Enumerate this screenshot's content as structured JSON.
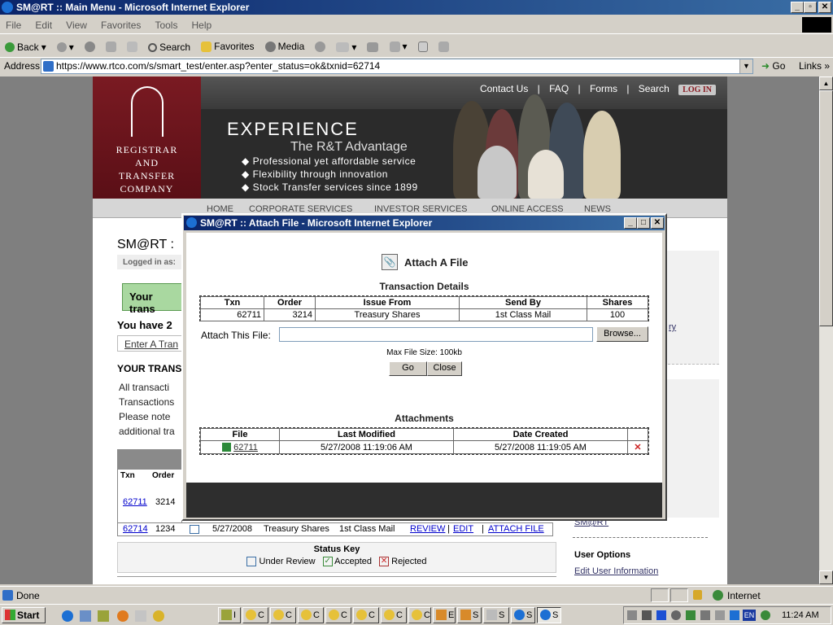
{
  "window": {
    "title": "SM@RT :: Main Menu - Microsoft Internet Explorer"
  },
  "menu": [
    "File",
    "Edit",
    "View",
    "Favorites",
    "Tools",
    "Help"
  ],
  "toolbar": {
    "back": "Back",
    "search": "Search",
    "favorites": "Favorites",
    "media": "Media"
  },
  "address": {
    "label": "Address",
    "url": "https://www.rtco.com/s/smart_test/enter.asp?enter_status=ok&txnid=62714",
    "go": "Go",
    "links": "Links"
  },
  "site": {
    "logo_lines": [
      "REGISTRAR",
      "AND",
      "TRANSFER",
      "COMPANY"
    ],
    "top_links": [
      "Contact Us",
      "|",
      "FAQ",
      "|",
      "Forms",
      "|",
      "Search"
    ],
    "login": "LOG IN",
    "headline": "EXPERIENCE",
    "tagline": "The R&T Advantage",
    "bullets": [
      "Professional yet affordable service",
      "Flexibility through innovation",
      "Stock Transfer services since 1899"
    ],
    "nav": [
      "HOME",
      "CORPORATE SERVICES",
      "INVESTOR SERVICES",
      "ONLINE ACCESS",
      "NEWS"
    ],
    "page_title": "SM@RT :",
    "logged_in": "Logged in as: ",
    "notice": "Your trans",
    "you_have": "You have 2",
    "enter_link": "Enter A Tran",
    "your_trans": "YOUR TRANS",
    "para": [
      "All transacti",
      "Transactions",
      "Please note",
      "additional tra"
    ],
    "right_link": "ry",
    "right_smart": "SM@RT",
    "user_options": "User Options",
    "edit_user": "Edit User Information"
  },
  "txn_table": {
    "headers": [
      "Txn",
      "Order"
    ],
    "row1": {
      "txn": "62711",
      "order": "3214"
    },
    "row2": {
      "txn": "62714",
      "order": "1234",
      "date": "5/27/2008",
      "issue": "Treasury Shares",
      "send": "1st Class Mail",
      "review": "REVIEW",
      "edit": "EDIT",
      "attach": "ATTACH FILE"
    }
  },
  "status_key": {
    "title": "Status Key",
    "under_review": "Under Review",
    "accepted": "Accepted",
    "rejected": "Rejected"
  },
  "popup": {
    "title": "SM@RT :: Attach File - Microsoft Internet Explorer",
    "heading": "Attach A File",
    "details_title": "Transaction Details",
    "details_headers": [
      "Txn",
      "Order",
      "Issue From",
      "Send By",
      "Shares"
    ],
    "details_row": [
      "62711",
      "3214",
      "Treasury Shares",
      "1st Class Mail",
      "100"
    ],
    "attach_label": "Attach This File:",
    "file_value": "",
    "browse": "Browse...",
    "max_size": "Max File Size: 100kb",
    "go": "Go",
    "close": "Close",
    "attachments_title": "Attachments",
    "att_headers": [
      "File",
      "Last Modified",
      "Date Created"
    ],
    "att_row": {
      "file": "62711",
      "modified": "5/27/2008 11:19:06 AM",
      "created": "5/27/2008 11:19:05 AM"
    }
  },
  "statusbar": {
    "text": "Done",
    "zone": "Internet"
  },
  "taskbar": {
    "start": "Start",
    "clock": "11:24 AM",
    "lang": "EN",
    "buttons": [
      "I",
      "C",
      "C",
      "C",
      "C",
      "C",
      "C",
      "C",
      "E",
      "S",
      "S",
      "S",
      "S"
    ]
  }
}
